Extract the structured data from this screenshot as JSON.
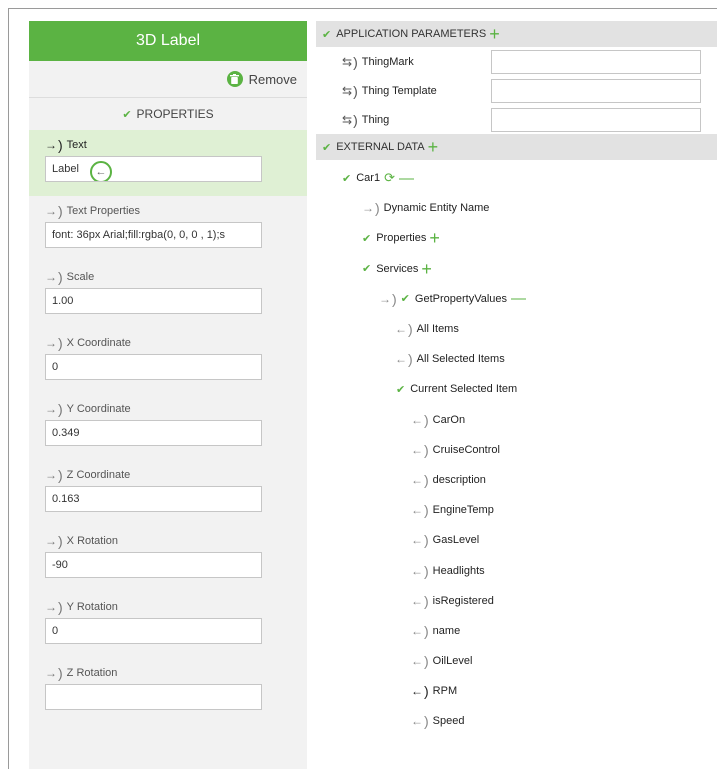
{
  "left": {
    "title": "3D Label",
    "remove_label": "Remove",
    "properties_label": "PROPERTIES",
    "props": [
      {
        "label": "Text",
        "value": "Label"
      },
      {
        "label": "Text Properties",
        "value": "font: 36px Arial;fill:rgba(0, 0, 0 , 1);s"
      },
      {
        "label": "Scale",
        "value": "1.00"
      },
      {
        "label": "X Coordinate",
        "value": "0"
      },
      {
        "label": "Y Coordinate",
        "value": "0.349"
      },
      {
        "label": "Z Coordinate",
        "value": "0.163"
      },
      {
        "label": "X Rotation",
        "value": "-90"
      },
      {
        "label": "Y Rotation",
        "value": "0"
      },
      {
        "label": "Z Rotation",
        "value": ""
      }
    ]
  },
  "right": {
    "app_params_title": "APPLICATION PARAMETERS",
    "app_params": [
      {
        "label": "ThingMark",
        "value": ""
      },
      {
        "label": "Thing Template",
        "value": ""
      },
      {
        "label": "Thing",
        "value": ""
      }
    ],
    "external_title": "EXTERNAL DATA",
    "tree": {
      "car1": "Car1",
      "dynamic_entity_name": "Dynamic Entity Name",
      "properties": "Properties",
      "services": "Services",
      "get_property_values": "GetPropertyValues",
      "all_items": "All Items",
      "all_selected_items": "All Selected Items",
      "current_selected_item": "Current Selected Item",
      "fields": [
        "CarOn",
        "CruiseControl",
        "description",
        "EngineTemp",
        "GasLevel",
        "Headlights",
        "isRegistered",
        "name",
        "OilLevel",
        "RPM",
        "Speed"
      ]
    }
  },
  "colors": {
    "accent": "#5bb343",
    "active_bg": "#dff0d4",
    "panel_bg": "#f2f2f2",
    "section_bg": "#e2e2e2"
  }
}
